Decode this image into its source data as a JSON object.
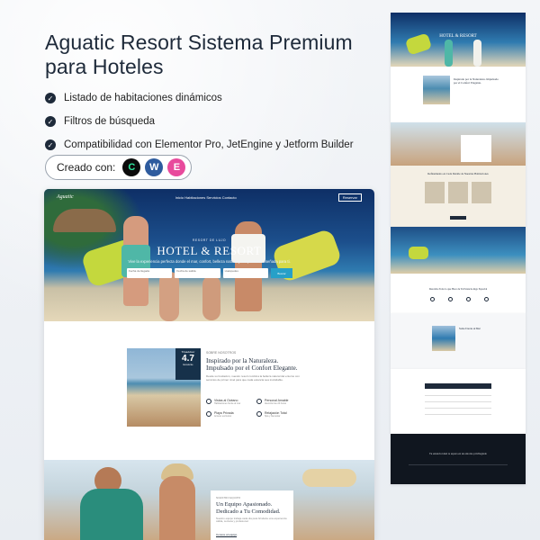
{
  "title": "Aguatic Resort Sistema Premium para Hoteles",
  "features": [
    "Listado de habitaciones dinámicos",
    "Filtros de búsqueda",
    "Compatibilidad con Elementor Pro, JetEngine y Jetform Builder"
  ],
  "created_with": {
    "label": "Creado con:",
    "badges": [
      {
        "name": "crocoblock-icon",
        "glyph": "C"
      },
      {
        "name": "wordpress-icon",
        "glyph": "W"
      },
      {
        "name": "elementor-icon",
        "glyph": "E"
      }
    ]
  },
  "preview": {
    "nav": {
      "logo": "Aguatic",
      "menu": "Inicio   Habitaciones   Servicios   Contacto",
      "cta": "Reservar"
    },
    "hero": {
      "kicker": "RESORT DE LUJO",
      "title": "HOTEL & RESORT",
      "subtitle": "Vive la experiencia perfecta donde el mar, confort, belleza natural y hospitalidad diseñada para ti.",
      "fields": [
        "Fecha de llegada",
        "Fecha de salida",
        "Huéspedes"
      ],
      "button": "Buscar"
    },
    "about": {
      "rating_label": "Tripadvisor",
      "rating": "4.7",
      "rating_sub": "Excelente",
      "kicker": "SOBRE NOSOTROS",
      "title": "Inspirado por la Naturaleza. Impulsado por el Confort Elegante.",
      "text": "Desde su fundación, nuestro resort combina la belleza natural del entorno con servicios de primer nivel para que cada estancia sea inolvidable.",
      "amenities": [
        {
          "label": "Vistas al Océano",
          "sub": "Habitaciones frente al mar"
        },
        {
          "label": "Personal Amable",
          "sub": "Atención las 24 horas"
        },
        {
          "label": "Playa Privada",
          "sub": "Acceso exclusivo"
        },
        {
          "label": "Relajación Total",
          "sub": "Spa y bienestar"
        }
      ]
    },
    "team": {
      "kicker": "NUESTRO EQUIPO",
      "title": "Un Equipo Apasionado. Dedicado a Tu Comodidad.",
      "text": "Nuestro equipo trabaja cada día para brindarte una experiencia cálida, cercana y profesional.",
      "link": "Conoce al equipo"
    }
  },
  "side": {
    "hero_title": "HOTEL & RESORT",
    "about_title": "Inspirado por la Naturaleza. Impulsado por el Confort Elegante.",
    "rooms_title": "Refinamiento en Cada Detalle de Nuestras Habitaciones",
    "white_title": "Descubre Todo lo que Hace de Tu Estancia Algo Especial",
    "single_text": "Suite Frente al Mar",
    "footer_title": "Tu estancia ideal te espera en un entorno privilegiado"
  },
  "colors": {
    "navy": "#1e2a3a",
    "accent": "#27a0c8",
    "lime": "#c4d83d"
  }
}
